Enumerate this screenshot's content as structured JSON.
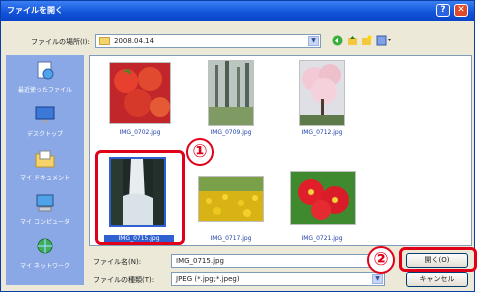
{
  "window": {
    "title": "ファイルを開く",
    "help_glyph": "?",
    "close_glyph": "✕"
  },
  "toolbar": {
    "look_in_label": "ファイルの場所(I):",
    "look_in_value": "2008.04.14",
    "icons": [
      "back-arrow-icon",
      "up-folder-icon",
      "new-folder-icon",
      "view-menu-icon"
    ]
  },
  "sidebar": {
    "items": [
      {
        "label": "最近使ったファイル",
        "icon": "recent-files-icon"
      },
      {
        "label": "デスクトップ",
        "icon": "desktop-icon"
      },
      {
        "label": "マイ ドキュメント",
        "icon": "my-documents-icon"
      },
      {
        "label": "マイ コンピュータ",
        "icon": "my-computer-icon"
      },
      {
        "label": "マイ ネットワーク",
        "icon": "my-network-icon"
      }
    ]
  },
  "files": [
    {
      "name": "IMG_0702.jpg",
      "subject": "tomatoes",
      "selected": false
    },
    {
      "name": "IMG_0709.jpg",
      "subject": "forest",
      "selected": false
    },
    {
      "name": "IMG_0712.jpg",
      "subject": "cherry-blossom",
      "selected": false
    },
    {
      "name": "IMG_0715.jpg",
      "subject": "waterfall",
      "selected": true
    },
    {
      "name": "IMG_0717.jpg",
      "subject": "sunflower-field",
      "selected": false
    },
    {
      "name": "IMG_0721.jpg",
      "subject": "red-flowers",
      "selected": false
    }
  ],
  "bottom": {
    "filename_label": "ファイル名(N):",
    "filename_value": "IMG_0715.jpg",
    "filetype_label": "ファイルの種類(T):",
    "filetype_value": "JPEG (*.jpg;*.jpeg)",
    "open_label": "開く(O)",
    "cancel_label": "キャンセル"
  },
  "annotations": {
    "callout_1": "①",
    "callout_2": "②",
    "color": "#e0001a"
  },
  "colors": {
    "title_bar": "#1152d8",
    "dialog_bg": "#ece9d8",
    "sidebar_bg": "#8ba8e6",
    "selection": "#2f5fd0"
  }
}
